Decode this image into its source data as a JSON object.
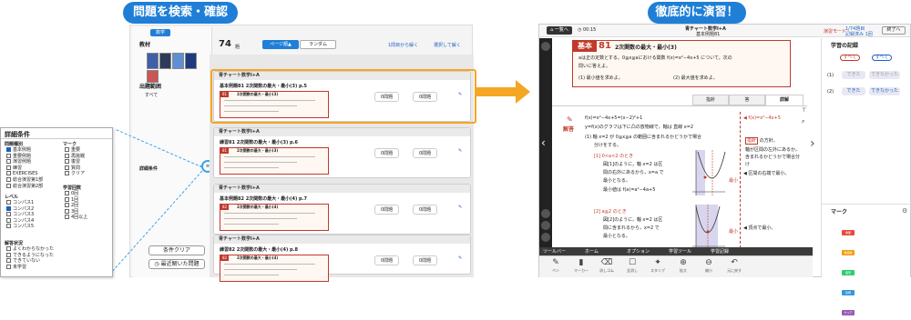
{
  "left": {
    "title_pill": "問題を検索・確認",
    "sidebar": {
      "tab": "数学",
      "section_material": "教材",
      "section_range": "出題範囲",
      "range_value": "すべて",
      "section_detail": "詳細条件",
      "clear_button": "条件クリア",
      "recent_button": "最近解いた問題"
    },
    "toolbar": {
      "count": "74",
      "count_unit": "題",
      "sort_page": "ページ順▲",
      "sort_random": "ランダム",
      "open_all": "1問目から解く",
      "open_selected": "選択して解く"
    },
    "detail_panel": {
      "title": "詳細条件",
      "col1_heading": "問題種別",
      "col1_items": [
        {
          "label": "基本例題",
          "checked": true
        },
        {
          "label": "重要例題",
          "checked": false
        },
        {
          "label": "演習例題",
          "checked": false
        },
        {
          "label": "練習",
          "checked": false
        },
        {
          "label": "EXERCISES",
          "checked": false
        },
        {
          "label": "総合演習第1部",
          "checked": false
        },
        {
          "label": "総合演習第2部",
          "checked": false
        }
      ],
      "col2_heading": "マーク",
      "col2_items": [
        {
          "label": "重要",
          "checked": false
        },
        {
          "label": "再挑戦",
          "checked": false
        },
        {
          "label": "復習",
          "checked": false
        },
        {
          "label": "質問",
          "checked": false
        },
        {
          "label": "クリア",
          "checked": false
        }
      ],
      "level_heading": "レベル",
      "level_items": [
        {
          "label": "コンパス1",
          "checked": false
        },
        {
          "label": "コンパス2",
          "checked": true
        },
        {
          "label": "コンパス3",
          "checked": false
        },
        {
          "label": "コンパス4",
          "checked": false
        },
        {
          "label": "コンパス5",
          "checked": false
        }
      ],
      "count_heading": "学習回数",
      "count_items": [
        {
          "label": "0回",
          "checked": false
        },
        {
          "label": "1回",
          "checked": false
        },
        {
          "label": "2回",
          "checked": false
        },
        {
          "label": "3回",
          "checked": false
        },
        {
          "label": "4回以上",
          "checked": false
        }
      ],
      "state_heading": "解答状況",
      "state_items": [
        {
          "label": "よくわからなかった",
          "checked": false
        },
        {
          "label": "できるようになった",
          "checked": false
        },
        {
          "label": "できていない",
          "checked": false
        },
        {
          "label": "未学習",
          "checked": false
        }
      ]
    },
    "cards": [
      {
        "book": "青チャート数学Ⅰ+A",
        "title": "基本例題81 2次関数の最大・最小(3) p.5",
        "badge": "81",
        "problem": "2次関数の最大・最小(3)",
        "btn1": "0問題",
        "btn2": "0問題"
      },
      {
        "book": "青チャート数学Ⅰ+A",
        "title": "練習81 2次関数の最大・最小(3) p.6",
        "badge": "81",
        "problem": "2次関数の最大・最小(3)",
        "btn1": "0問題",
        "btn2": "0問題"
      },
      {
        "book": "青チャート数学Ⅰ+A",
        "title": "基本例題82 2次関数の最大・最小(4) p.7",
        "badge": "82",
        "problem": "2次関数の最大・最小(4)",
        "btn1": "0問題",
        "btn2": "0問題"
      },
      {
        "book": "青チャート数学Ⅰ+A",
        "title": "練習82 2次関数の最大・最小(4) p.8",
        "badge": "82",
        "problem": "2次関数の最大・最小(4)",
        "btn1": "0問題",
        "btn2": "0問題"
      }
    ]
  },
  "right": {
    "title_pill": "徹底的に演習！",
    "header": {
      "home": "一覧へ",
      "timer": "00:15",
      "book_title": "青チャート数学Ⅰ+A",
      "sub_title": "基本例題81",
      "progress1": "1/74題目",
      "progress2": "記録済み 1回",
      "exit": "終了へ",
      "mode": "演習モード"
    },
    "problem": {
      "category": "基本",
      "number": "81",
      "title": "2次関数の最大・最小(3)",
      "text1": "aは正の定数とする。0≦x≦aにおける関数 f(x)=x²−4x+5 について，次の",
      "text2": "問いに答えよ。",
      "q1": "(1) 最小値を求めよ。",
      "q2": "(2) 最大値を求めよ。"
    },
    "tabs": [
      "指針",
      "答",
      "詳解"
    ],
    "solution": {
      "label": "解答",
      "line1": "f(x)=x²−4x+5=(x−2)²+1",
      "line2": "y=f(x)のグラフは下に凸の放物線で，軸は 直線 x=2",
      "line3": "(1) 軸 x=2 が 0≦x≦a の範囲に含まれるかどうかで場合",
      "line4": "分けをする。",
      "case1": "[1] 0<a<2 のとき",
      "case1a": "図[1]のように，軸 x=2 は区",
      "case1b": "間の右外にあるから，x=a で",
      "case1c": "最小となる。",
      "case1d": "最小値は f(a)=a²−4a+5",
      "case2": "[2] a≧2 のとき",
      "case2a": "図[2]のように，軸 x=2 は区",
      "case2b": "間に含まれるから，x=2 で",
      "case2c": "最小となる。",
      "side1": "◀ f(x)=x²−4x+5",
      "side2": "指針",
      "side3": "の方針。",
      "side4": "軸が区間の左外にあるか，含まれるかどうかで場合分け",
      "side5": "◀ 区間の右端で最小。",
      "side6": "◀ 頂点で最小。",
      "graph_label1": "最小",
      "graph_label2": "最小"
    },
    "bottom_tabs": [
      "ツールバー",
      "ホーム",
      "オプション",
      "学習ツール",
      "学習記録"
    ],
    "tools": [
      "ペン",
      "マーカー",
      "消しゴム",
      "全消し",
      "スタンプ",
      "拡大",
      "縮小",
      "元に戻す"
    ],
    "record": {
      "title": "学習の記録",
      "row1": "(1)",
      "row2": "(2)",
      "btn_ok": "できた",
      "btn_bad": "できなかった",
      "top1": "すべて",
      "top2": "すべて",
      "mark_title": "マーク",
      "marks": [
        "重要",
        "再挑戦",
        "復習",
        "質問",
        "クリア"
      ]
    },
    "colors": {
      "accent": "#1f7fd6",
      "problem_red": "#c0392b",
      "highlight_orange": "#f5a623",
      "mark_colors": [
        "#e74c3c",
        "#f39c12",
        "#2ecc71",
        "#3498db",
        "#9b59b6"
      ]
    }
  }
}
